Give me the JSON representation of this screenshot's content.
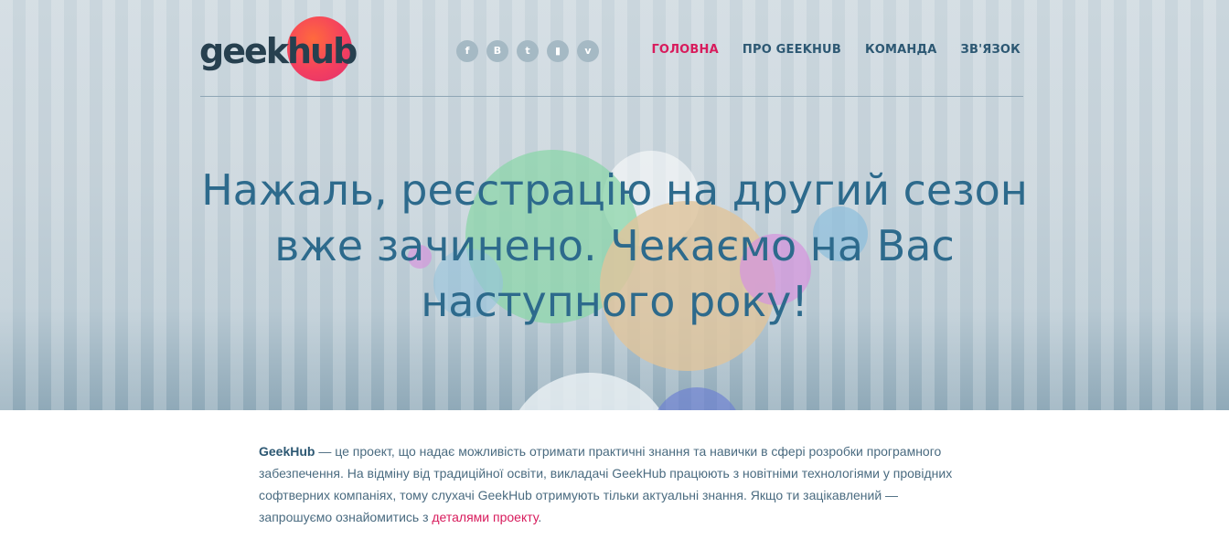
{
  "header": {
    "logo": {
      "part1": "geek",
      "part2": "hub"
    },
    "social": [
      {
        "name": "facebook-icon",
        "glyph": "f"
      },
      {
        "name": "vkontakte-icon",
        "glyph": "B"
      },
      {
        "name": "twitter-icon",
        "glyph": "t"
      },
      {
        "name": "youtube-icon",
        "glyph": "▮"
      },
      {
        "name": "vimeo-icon",
        "glyph": "v"
      }
    ],
    "nav": [
      {
        "label": "ГОЛОВНА",
        "active": true
      },
      {
        "label": "ПРО GEEKHUB",
        "active": false
      },
      {
        "label": "КОМАНДА",
        "active": false
      },
      {
        "label": "ЗВ'ЯЗОК",
        "active": false
      }
    ]
  },
  "hero": {
    "headline_line1": "Нажаль, реєстрацію на другий сезон",
    "headline_line2": "вже зачинено. Чекаємо на Вас",
    "headline_line3": "наступного року!"
  },
  "about": {
    "brand": "GeekHub",
    "text_before_link": " — це проект, що надає можливість отримати практичні знання та навички в сфері розробки програмного забезпечення. На відміну від традиційної освіти, викладачі GeekHub працюють з новітніми технологіями у провідних софтверних компаніях, тому слухачі GeekHub отримують тільки актуальні знання. Якщо ти зацікавлений — запрошуємо ознайомитись з ",
    "link_text": "деталями проекту",
    "text_after_link": "."
  },
  "colors": {
    "accent": "#d81b5c",
    "headline": "#2d6a8c",
    "nav": "#2d5873",
    "body_text": "#4a6b80"
  }
}
